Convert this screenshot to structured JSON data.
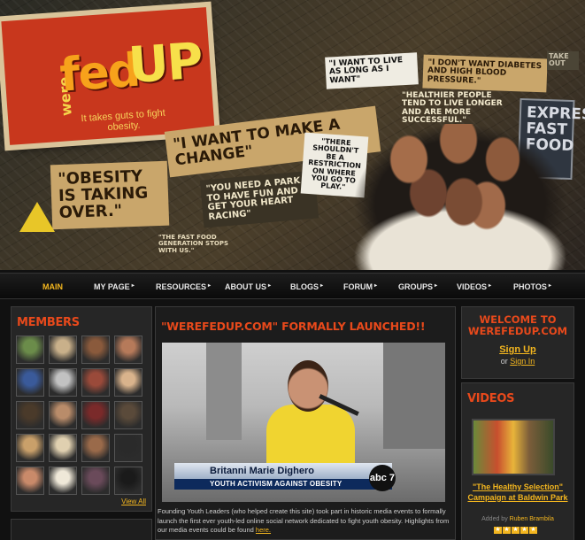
{
  "header": {
    "logo": {
      "were": "were",
      "fed": "fed",
      "up": "UP",
      "tagline": "It takes guts to fight obesity."
    },
    "quotes": {
      "live_long": "\"I want to live as long as I want\"",
      "diabetes": "\"I don't want diabetes and high blood pressure.\"",
      "healthier": "\"Healthier people tend to live longer and are more successful.\"",
      "change": "\"I want to make a change\"",
      "obesity": "\"Obesity is taking over.\"",
      "park": "\"You need a park to have fun and get your heart racing\"",
      "restriction": "\"There shouldn't be a restriction on where you go to play.\"",
      "fast_food_gen": "\"The fast food generation stops with us.\"",
      "express": "Express Fast Food",
      "take_out": "Take Out"
    }
  },
  "nav": {
    "items": [
      {
        "label": "Main",
        "active": true
      },
      {
        "label": "My Page"
      },
      {
        "label": "Resources"
      },
      {
        "label": "About Us"
      },
      {
        "label": "Blogs"
      },
      {
        "label": "Forum"
      },
      {
        "label": "Groups"
      },
      {
        "label": "Videos"
      },
      {
        "label": "Photos"
      }
    ]
  },
  "members": {
    "title": "MEMBERS",
    "view_all": "View All",
    "count": 20
  },
  "main": {
    "headline": "\"WEREFEDUP.COM\" FORMALLY LAUNCHED!!",
    "video": {
      "lower_third_name": "Britanni Marie Dighero",
      "lower_third_sub": "YOUTH ACTIVISM AGAINST OBESITY",
      "network": "abc 7"
    },
    "body": "Founding Youth Leaders (who helped create this site) took part in historic media events to formally launch the first ever youth-led online social network dedicated to fight youth obesity. Highlights from our media events could be found",
    "link": "here."
  },
  "welcome": {
    "title": "WELCOME TO WEREFEDUP.COM",
    "signup": "Sign Up",
    "or": "or",
    "signin": "Sign In"
  },
  "videos": {
    "title": "VIDEOS",
    "video_title": "\"The Healthy Selection\" Campaign at Baldwin Park",
    "added_by": "Added by",
    "author": "Ruben Brambila",
    "rating": 5
  },
  "colors": {
    "accent_orange": "#e8491b",
    "link_gold": "#f3b61f",
    "background": "#111111"
  }
}
